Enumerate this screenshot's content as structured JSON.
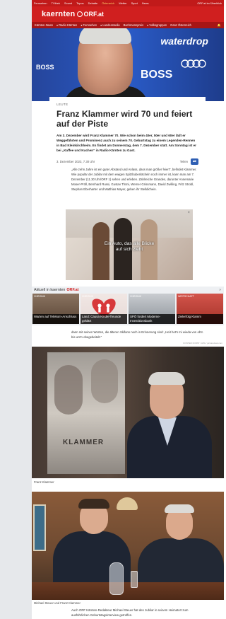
{
  "top_nav": {
    "items": [
      "Fernsehen",
      "TVthek",
      "Sound",
      "Topos",
      "Debatte",
      "Österreich",
      "Wetter",
      "Sport",
      "News"
    ],
    "right_link": "ORF.at im Überblick"
  },
  "brand": {
    "name": "kaernten",
    "orf": "ORF.at"
  },
  "sub_nav": {
    "items": [
      "Kärnten-News",
      "Radio Kärnten",
      "Fernsehen",
      "Landesstudio",
      "Bachmannpreis",
      "Volksgruppen",
      "Ganz Österreich"
    ]
  },
  "hero": {
    "waterdrop": "waterdrop",
    "boss1": "BOSS",
    "boss2": "BOSS"
  },
  "article": {
    "kicker": "LEUTE",
    "title": "Franz Klammer wird 70 und feiert auf der Piste",
    "lead": "Am 3. Dezember wird Franz Klammer 70. Wie schon beim 40er, 50er und 60er lädt er Weggefährten und Prominenz auch zu seinem 70. Geburtstag zu einem Legenden-Rennen in Bad Kleinkirchheim. Es findet am Donnerstag, dem 7. Dezember statt. Am Sonntag ist er bei „Kaffee und Kuchen“ in Radio Kärnten zu Gast.",
    "date": "3. Dezember 2023, 7.30 Uhr",
    "share_label": "Teilen",
    "quote": "„Alle zehn Jahre ist ein guter Abstand und Anlass, dass man größer feiert“, befindet Klammer. Wie populär der Jubilar mit dem ewigen Spitzbubenlächeln noch immer ist, kann man am 7. Dezember (11.30 Uhr/ORF 1) sehen und erleben. Zahlreiche Grandes, darunter Annemarie Moser-Pröll, Bernhard Russi, Gustav Thöni, Werner Grissmann, David Zwilling, Fritz Strobl, Stephan Eberharter und Matthias Mayer, geben ihr Stelldichein.",
    "para2": "dann mit seinen Worten, die älteren Skifans noch in Erinnerung sind: „Heit hot's mi wieda von ob'n bis unt'n obegebeitelt.“",
    "credit1": "KONTER FORST / APA / picturedesk.com",
    "caption1": "Franz Klammer",
    "caption2": "Michael Steuer und Franz Klammer",
    "para3": "Auch ORF Kärnten-Redakteur Michael Steuer hat den Jubilar in seinem Heimatort zum ausführlichen Geburtstagsinterview getroffen."
  },
  "ad": {
    "caption_line1": "Ein Auto, das alle Blicke",
    "caption_line2": "auf sich zieht",
    "close": "×"
  },
  "aktuell": {
    "label": "Aktuell in kaernten",
    "orf": "ORF.at",
    "more": "»",
    "tiles": [
      {
        "tag": "CHRONIK",
        "text": "Warten auf Telekom-Anschluss",
        "color": "#7a5a3f"
      },
      {
        "tag": "CHRONIK",
        "text": "Land: Causa Kinder-freunde geklärt",
        "color": "#d54b4b"
      },
      {
        "tag": "CHRONIK",
        "text": "SPÖ fordert Moderne-Investitionsbank",
        "color": "#9aa3ad"
      },
      {
        "tag": "WIRTSCHAFT",
        "text": "Zielerfolg Klamm",
        "color": "#c44b3a"
      }
    ]
  },
  "poster": {
    "title": "KLAMMER"
  }
}
